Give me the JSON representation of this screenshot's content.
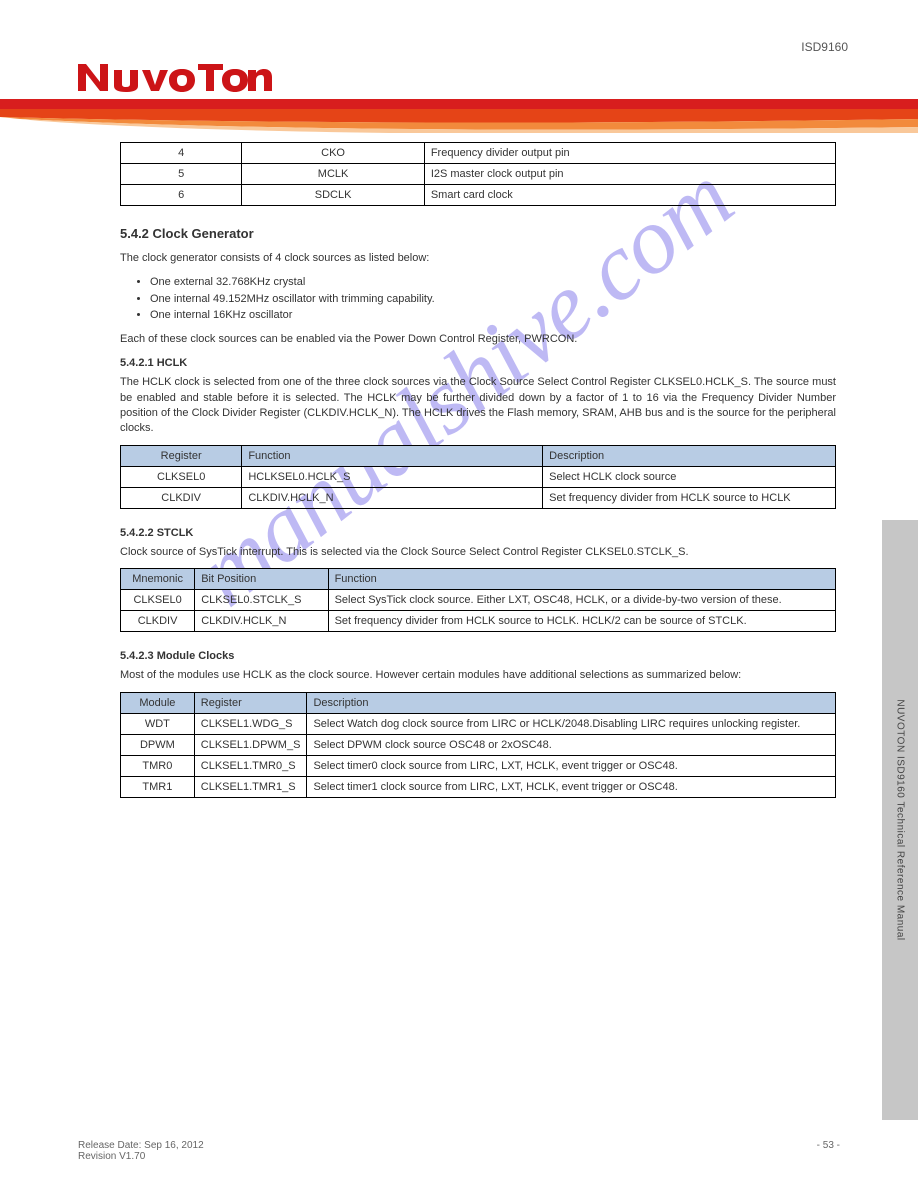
{
  "header": {
    "right": "ISD9160"
  },
  "watermark": "manualshive.com",
  "table0": {
    "rows": [
      [
        "4",
        "CKO",
        "Frequency divider output pin"
      ],
      [
        "5",
        "MCLK",
        "I2S master clock output pin"
      ],
      [
        "6",
        "SDCLK",
        "Smart card clock"
      ]
    ]
  },
  "section": {
    "title": "5.4.2  Clock Generator",
    "p1": "The clock generator consists of 4 clock sources as listed below:",
    "bullets": [
      "One external 32.768KHz crystal",
      "One internal 49.152MHz oscillator with trimming capability.",
      "One internal 16KHz oscillator"
    ],
    "p2": "Each of these clock sources can be enabled via the Power Down Control Register, PWRCON.",
    "sub1": "5.4.2.1   HCLK",
    "sub1p": "The HCLK clock is selected from one of the three clock sources via the Clock Source Select Control Register CLKSEL0.HCLK_S. The source must be enabled and stable before it is selected. The HCLK may be further divided down by a factor of 1 to 16 via the Frequency Divider Number position of the Clock Divider Register (CLKDIV.HCLK_N). The HCLK drives the Flash memory, SRAM, AHB bus and is the source for the peripheral clocks.",
    "t1": {
      "head": [
        "Register",
        "Function",
        "Description"
      ],
      "rows": [
        [
          "CLKSEL0",
          "HCLKSEL0.HCLK_S",
          "Select HCLK clock source"
        ],
        [
          "CLKDIV",
          "CLKDIV.HCLK_N",
          "Set frequency divider from HCLK source to HCLK"
        ]
      ]
    },
    "sub2": "5.4.2.2   STCLK",
    "sub2p": "Clock source of SysTick interrupt. This is selected via the Clock Source Select Control Register CLKSEL0.STCLK_S.",
    "t2": {
      "head": [
        "Mnemonic",
        "Bit Position",
        "Function"
      ],
      "rows": [
        [
          "CLKSEL0",
          "CLKSEL0.STCLK_S",
          "Select SysTick clock source. Either LXT, OSC48, HCLK, or a divide-by-two version of these."
        ],
        [
          "CLKDIV",
          "CLKDIV.HCLK_N",
          "Set frequency divider from HCLK source to HCLK. HCLK/2 can be source of STCLK."
        ]
      ]
    },
    "sub3": "5.4.2.3   Module Clocks",
    "sub3p": "Most of the modules use HCLK as the clock source. However certain modules have additional selections as summarized below:",
    "t3": {
      "head": [
        "Module",
        "Register",
        "Description"
      ],
      "rows": [
        [
          "WDT",
          "CLKSEL1.WDG_S",
          "Select Watch dog clock source from LIRC or HCLK/2048.Disabling LIRC requires unlocking register."
        ],
        [
          "DPWM",
          "CLKSEL1.DPWM_S",
          "Select DPWM clock source OSC48 or 2xOSC48."
        ],
        [
          "TMR0",
          "CLKSEL1.TMR0_S",
          "Select timer0 clock source from LIRC, LXT, HCLK, event trigger or OSC48."
        ],
        [
          "TMR1",
          "CLKSEL1.TMR1_S",
          "Select timer1 clock source from LIRC, LXT, HCLK, event trigger or OSC48."
        ]
      ]
    }
  },
  "footer": {
    "left": "Release Date: Sep 16, 2012",
    "right": "- 53 -",
    "rev": "Revision V1.70"
  },
  "side": "NUVOTON ISD9160 Technical Reference Manual"
}
